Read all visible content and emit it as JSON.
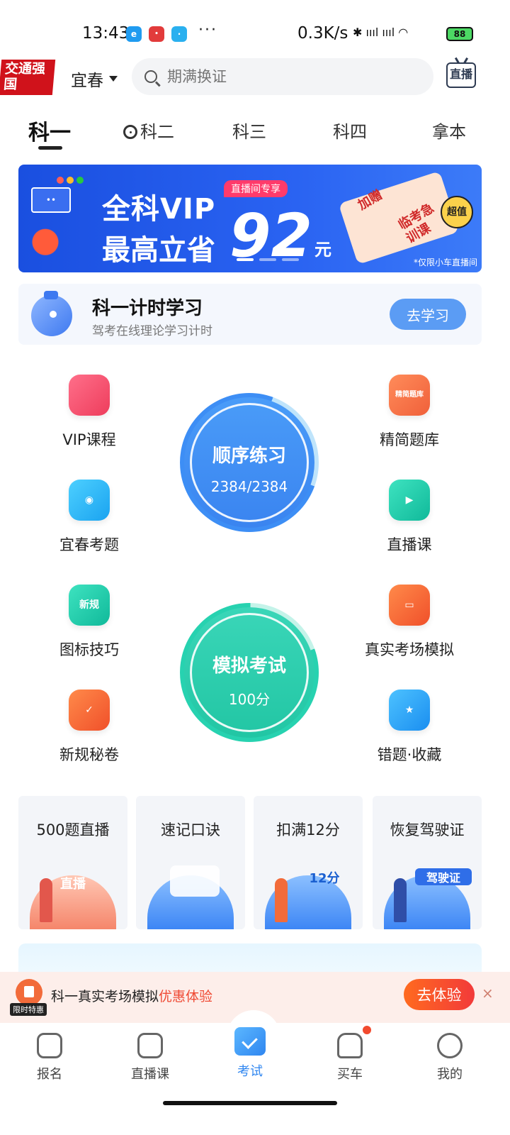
{
  "status_bar": {
    "time": "13:43",
    "dots": "···",
    "net_speed": "0.3K/s",
    "battery": "88"
  },
  "header": {
    "logo_text": "交通强国",
    "city": "宜春",
    "search_placeholder": "期满换证",
    "live_label": "直播"
  },
  "tabs": [
    "科一",
    "科二",
    "科三",
    "科四",
    "拿本"
  ],
  "banner": {
    "title_line1": "全科VIP",
    "title_line2": "最高立省",
    "amount": "92",
    "unit": "元",
    "tag": "直播间专享",
    "coupon_text1": "加赠",
    "coupon_text2": "临考急训课",
    "badge": "超值",
    "footnote": "*仅限小车直播间"
  },
  "study_card": {
    "title": "科一计时学习",
    "subtitle": "驾考在线理论学习计时",
    "button": "去学习"
  },
  "features": {
    "vip": "VIP课程",
    "local": "宜春考题",
    "signs": "图标技巧",
    "secret": "新规秘卷",
    "bank": "精简题库",
    "live": "直播课",
    "exam_sim": "真实考场模拟",
    "wrong": "错题·收藏",
    "bank_icon_text": "精简题库",
    "signs_icon_text": "新规"
  },
  "practice": {
    "title": "顺序练习",
    "progress": "2384/2384"
  },
  "exam": {
    "title": "模拟考试",
    "score": "100分"
  },
  "cards": [
    {
      "title": "500题直播",
      "art": "直播"
    },
    {
      "title": "速记口诀",
      "art": ""
    },
    {
      "title": "扣满12分",
      "art": "12分"
    },
    {
      "title": "恢复驾驶证",
      "art": "驾驶证"
    }
  ],
  "promo": {
    "tag": "限时特惠",
    "text": "科一真实考场模拟",
    "highlight": "优惠体验",
    "button": "去体验",
    "close": "×"
  },
  "bottom_nav": [
    "报名",
    "直播课",
    "考试",
    "买车",
    "我的"
  ],
  "colors": {
    "primary": "#2f86f0",
    "practice_circle": "#3d8ef5",
    "exam_circle": "#27d2b0",
    "promo_button": "#f23a3a"
  }
}
